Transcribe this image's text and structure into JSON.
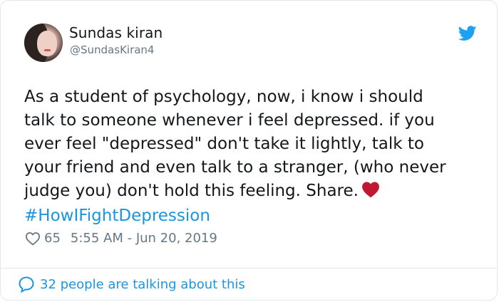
{
  "tweet": {
    "author_name": "Sundas kiran",
    "author_handle": "@SundasKiran4",
    "text": "As a student of psychology, now, i know i should\ntalk to someone whenever i feel depressed. if you\never feel \"depressed\" don't take it lightly, talk to\nyour friend and even talk to a stranger, (who never\njudge you) don't hold this feeling. Share.",
    "hashtag": "#HowIFightDepression",
    "likes": "65",
    "timestamp": "5:55 AM - Jun 20, 2019",
    "talking": "32 people are talking about this"
  },
  "icons": {
    "brand": "twitter-bird-icon",
    "like": "heart-outline-icon",
    "inline_emoji": "red-heart-emoji",
    "reply": "speech-bubble-icon"
  },
  "colors": {
    "brand": "#1da1f2",
    "link": "#1b95e0",
    "muted": "#657786",
    "text": "#14171a",
    "heart": "#be1931",
    "border": "#e1e8ed"
  }
}
